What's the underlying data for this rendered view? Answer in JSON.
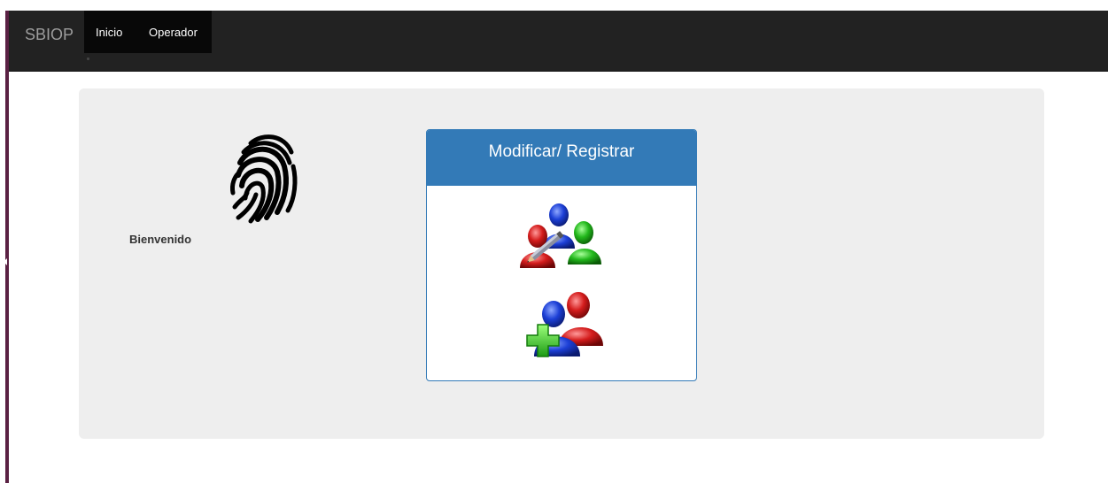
{
  "navbar": {
    "brand": "SBIOP",
    "links": [
      "Inicio",
      "Operador"
    ]
  },
  "main": {
    "welcome": "Bienvenido",
    "panel": {
      "title": "Modificar/ Registrar"
    }
  },
  "icons": {
    "fingerprint": "fingerprint-icon",
    "modify": "users-edit-icon",
    "register": "users-add-icon"
  },
  "colors": {
    "navbar": "#222222",
    "panel_primary": "#337ab7",
    "jumbotron": "#eeeeee",
    "left_bar": "#5a2143"
  }
}
